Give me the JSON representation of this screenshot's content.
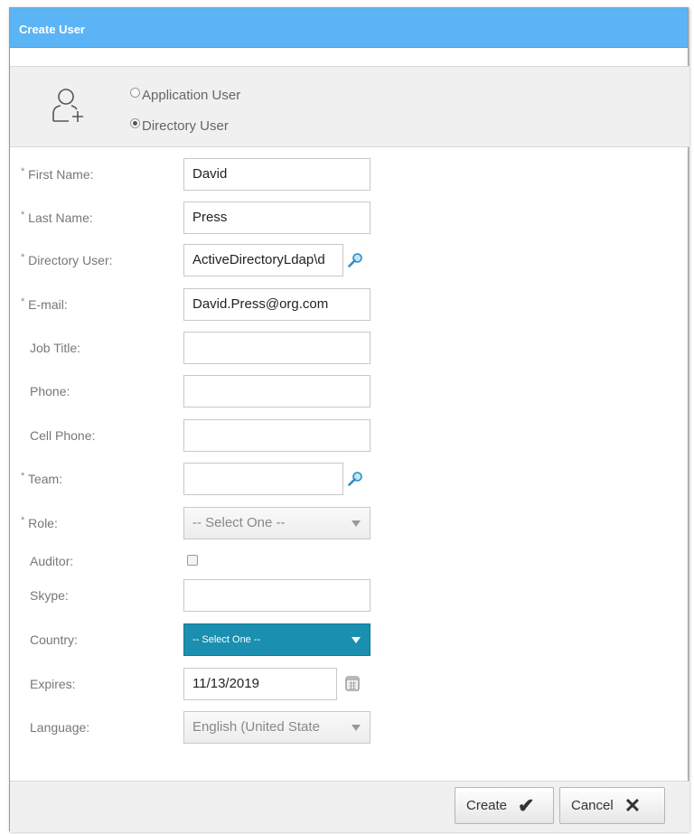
{
  "dialog": {
    "title": "Create User"
  },
  "user_type": {
    "options": [
      {
        "label": "Application User",
        "selected": false
      },
      {
        "label": "Directory User",
        "selected": true
      }
    ]
  },
  "form": {
    "first_name": {
      "label": "First Name:",
      "required": true,
      "value": "David"
    },
    "last_name": {
      "label": "Last Name:",
      "required": true,
      "value": "Press"
    },
    "directory_user": {
      "label": "Directory User:",
      "required": true,
      "value": "ActiveDirectoryLdap\\d"
    },
    "email": {
      "label": "E-mail:",
      "required": true,
      "value": "David.Press@org.com"
    },
    "job_title": {
      "label": "Job Title:",
      "required": false,
      "value": ""
    },
    "phone": {
      "label": "Phone:",
      "required": false,
      "value": ""
    },
    "cell_phone": {
      "label": "Cell Phone:",
      "required": false,
      "value": ""
    },
    "team": {
      "label": "Team:",
      "required": true,
      "value": ""
    },
    "role": {
      "label": "Role:",
      "required": true,
      "selected": "-- Select One --"
    },
    "auditor": {
      "label": "Auditor:",
      "checked": false
    },
    "skype": {
      "label": "Skype:",
      "required": false,
      "value": ""
    },
    "country": {
      "label": "Country:",
      "selected": "-- Select One --"
    },
    "expires": {
      "label": "Expires:",
      "value": "11/13/2019"
    },
    "language": {
      "label": "Language:",
      "selected": "English (United State"
    }
  },
  "required_marker": "*",
  "buttons": {
    "create": {
      "label": "Create",
      "icon": "checkmark-icon"
    },
    "cancel": {
      "label": "Cancel",
      "icon": "x-close-icon"
    }
  },
  "colors": {
    "title_bar": "#5bb4f5",
    "country_select": "#1a8fb0"
  }
}
